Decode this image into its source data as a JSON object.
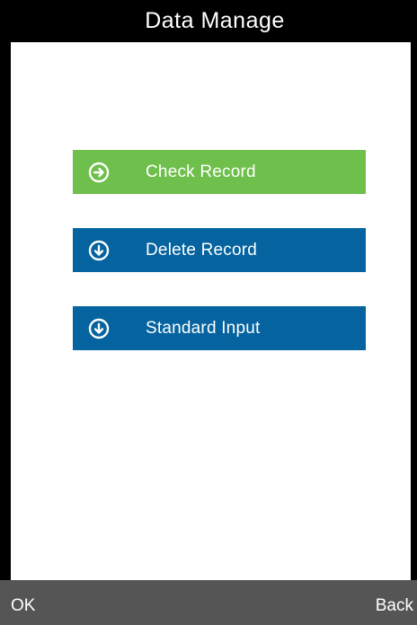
{
  "header": {
    "title": "Data Manage"
  },
  "menu": {
    "items": [
      {
        "label": "Check Record",
        "icon": "arrow-right-circle-icon",
        "color": "#6ebf4b",
        "selected": true
      },
      {
        "label": "Delete Record",
        "icon": "arrow-down-circle-icon",
        "color": "#05639f",
        "selected": false
      },
      {
        "label": "Standard Input",
        "icon": "arrow-down-circle-icon",
        "color": "#05639f",
        "selected": false
      }
    ]
  },
  "footer": {
    "left_key": "OK",
    "right_key": "Back"
  },
  "colors": {
    "selected": "#6ebf4b",
    "unselected": "#05639f",
    "bars": "#000000",
    "softkey_bar": "#555555"
  }
}
